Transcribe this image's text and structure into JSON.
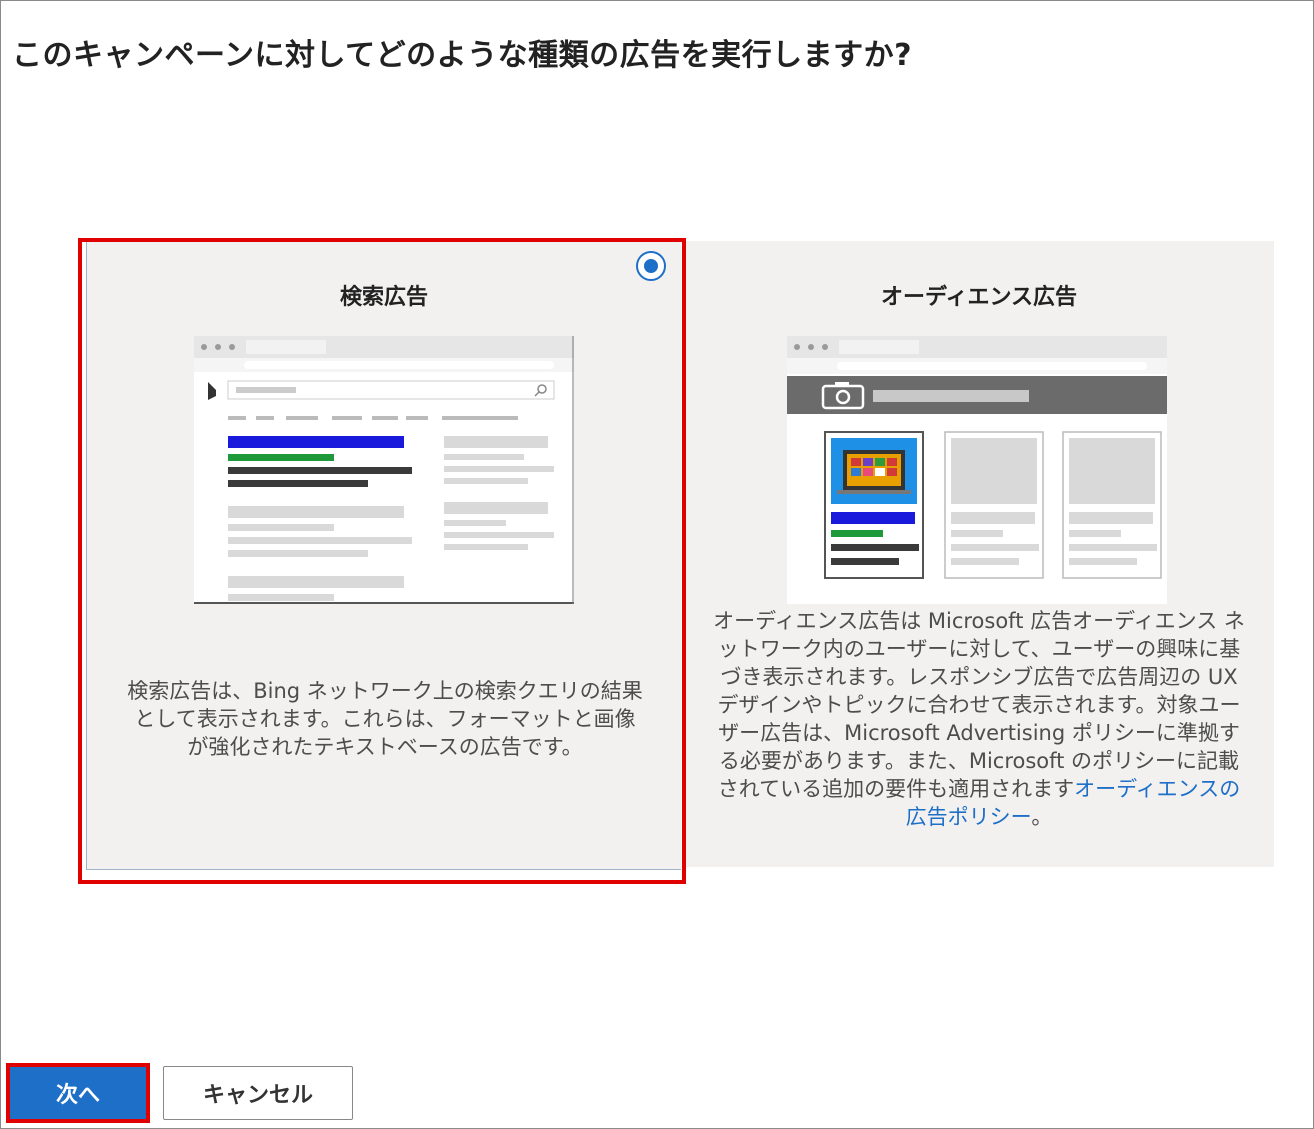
{
  "page": {
    "title": "このキャンペーンに対してどのような種類の広告を実行しますか?"
  },
  "options": {
    "search": {
      "title": "検索広告",
      "description": "検索広告は、Bing ネットワーク上の検索クエリの結果として表示されます。これらは、フォーマットと画像が強化されたテキストベースの広告です。",
      "selected": true
    },
    "audience": {
      "title": "オーディエンス広告",
      "description": "オーディエンス広告は Microsoft 広告オーディエンス ネットワーク内のユーザーに対して、ユーザーの興味に基づき表示されます。レスポンシブ広告で広告周辺の UX デザインやトピックに合わせて表示されます。対象ユーザー広告は、Microsoft Advertising ポリシーに準拠する必要があります。また、Microsoft のポリシーに記載されている追加の要件も適用されます",
      "link_text": "オーディエンスの広告ポリシー",
      "after_link": "。",
      "selected": false
    }
  },
  "buttons": {
    "next_label": "次へ",
    "cancel_label": "キャンセル"
  },
  "colors": {
    "accent": "#1e6fc8",
    "highlight": "#e00000",
    "card_bg": "#f2f1f0"
  },
  "icons": {
    "search_mock_logo": "bing-logo-icon",
    "search_mock_magnifier": "search-icon",
    "audience_mock_camera": "camera-icon"
  }
}
